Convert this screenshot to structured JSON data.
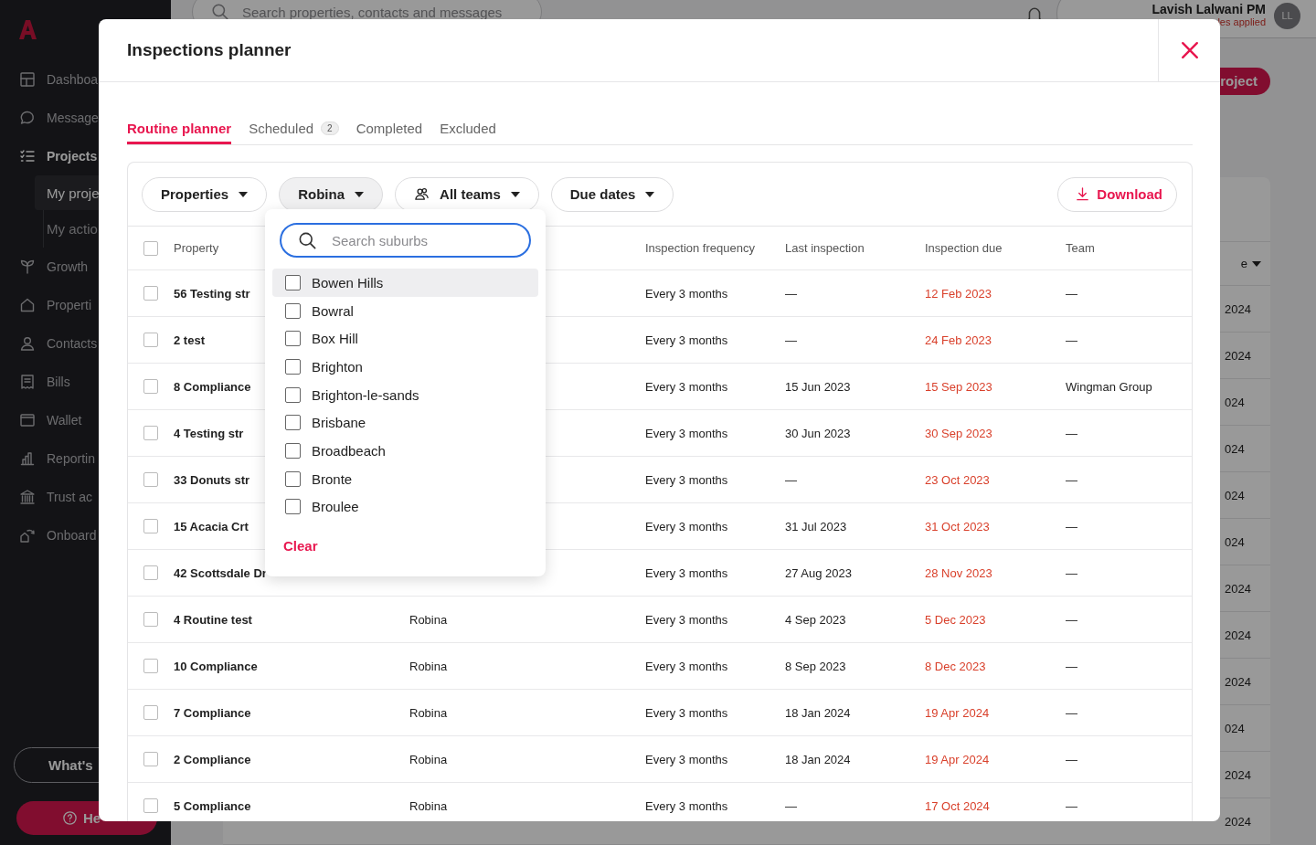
{
  "sidebar": {
    "items": [
      {
        "label": "Dashboa",
        "selected": false
      },
      {
        "label": "Message",
        "selected": false
      },
      {
        "label": "Projects",
        "selected": true,
        "children": [
          {
            "label": "My proje",
            "selected": true
          },
          {
            "label": "My actio",
            "selected": false
          }
        ]
      },
      {
        "label": "Growth",
        "selected": false
      },
      {
        "label": "Properti",
        "selected": false
      },
      {
        "label": "Contacts",
        "selected": false
      },
      {
        "label": "Bills",
        "selected": false
      },
      {
        "label": "Wallet",
        "selected": false
      },
      {
        "label": "Reportin",
        "selected": false
      },
      {
        "label": "Trust ac",
        "selected": false
      },
      {
        "label": "Onboard",
        "selected": false
      }
    ],
    "whats_new_button": "What's",
    "help_button": "He"
  },
  "top_bar": {
    "search": {
      "placeholder": "Search properties, contacts and messages"
    },
    "user": {
      "name": "Lavish Lalwani PM",
      "subtitle": "les applied",
      "avatar": "LL"
    }
  },
  "background": {
    "new_button": "roject",
    "sort_header": "e",
    "column_fragments": [
      "2024",
      "2024",
      "024",
      "024",
      "024",
      "024",
      "2024",
      "2024",
      "2024",
      "024",
      "2024",
      "2024"
    ]
  },
  "modal": {
    "title": "Inspections planner",
    "tabs": [
      {
        "label": "Routine planner",
        "selected": true
      },
      {
        "label": "Scheduled",
        "badge": "2",
        "selected": false
      },
      {
        "label": "Completed",
        "selected": false
      },
      {
        "label": "Excluded",
        "selected": false
      }
    ],
    "filters": [
      {
        "label": "Properties",
        "kind": "plain",
        "open": false
      },
      {
        "label": "Robina",
        "kind": "plain",
        "open": true
      },
      {
        "label": "All teams",
        "kind": "team",
        "open": false
      },
      {
        "label": "Due dates",
        "kind": "plain",
        "open": false
      }
    ],
    "download_button": "Download",
    "table": {
      "columns": [
        "Property",
        null,
        "Inspection frequency",
        "Last inspection",
        "Inspection due",
        "Team"
      ],
      "all_checked": false,
      "rows": [
        {
          "checked": false,
          "property": "56 Testing str",
          "frequency": "Every 3 months",
          "last": "—",
          "due": "12 Feb 2023",
          "team": "—"
        },
        {
          "checked": false,
          "property": "2 test",
          "frequency": "Every 3 months",
          "last": "—",
          "due": "24 Feb 2023",
          "team": "—"
        },
        {
          "checked": false,
          "property": "8 Compliance",
          "frequency": "Every 3 months",
          "last": "15 Jun 2023",
          "due": "15 Sep 2023",
          "team": "Wingman Group"
        },
        {
          "checked": false,
          "property": "4 Testing str",
          "frequency": "Every 3 months",
          "last": "30 Jun 2023",
          "due": "30 Sep 2023",
          "team": "—"
        },
        {
          "checked": false,
          "property": "33 Donuts str",
          "frequency": "Every 3 months",
          "last": "—",
          "due": "23 Oct 2023",
          "team": "—"
        },
        {
          "checked": false,
          "property": "15 Acacia Crt",
          "frequency": "Every 3 months",
          "last": "31 Jul 2023",
          "due": "31 Oct 2023",
          "team": "—"
        },
        {
          "checked": false,
          "property": "42 Scottsdale Dr",
          "frequency": "Every 3 months",
          "last": "27 Aug 2023",
          "due": "28 Nov 2023",
          "team": "—"
        },
        {
          "checked": false,
          "property": "4 Routine test",
          "suburb": "Robina",
          "frequency": "Every 3 months",
          "last": "4 Sep 2023",
          "due": "5 Dec 2023",
          "team": "—"
        },
        {
          "checked": false,
          "property": "10 Compliance",
          "suburb": "Robina",
          "frequency": "Every 3 months",
          "last": "8 Sep 2023",
          "due": "8 Dec 2023",
          "team": "—"
        },
        {
          "checked": false,
          "property": "7 Compliance",
          "suburb": "Robina",
          "frequency": "Every 3 months",
          "last": "18 Jan 2024",
          "due": "19 Apr 2024",
          "team": "—"
        },
        {
          "checked": false,
          "property": "2 Compliance",
          "suburb": "Robina",
          "frequency": "Every 3 months",
          "last": "18 Jan 2024",
          "due": "19 Apr 2024",
          "team": "—"
        },
        {
          "checked": false,
          "property": "5 Compliance",
          "suburb": "Robina",
          "frequency": "Every 3 months",
          "last": "—",
          "due": "17 Oct 2024",
          "team": "—"
        }
      ]
    },
    "suburb_dropdown": {
      "search": {
        "placeholder": "Search suburbs"
      },
      "options": [
        {
          "label": "Bowen Hills",
          "checked": false,
          "highlighted": true
        },
        {
          "label": "Bowral",
          "checked": false,
          "highlighted": false
        },
        {
          "label": "Box Hill",
          "checked": false,
          "highlighted": false
        },
        {
          "label": "Brighton",
          "checked": false,
          "highlighted": false
        },
        {
          "label": "Brighton-le-sands",
          "checked": false,
          "highlighted": false
        },
        {
          "label": "Brisbane",
          "checked": false,
          "highlighted": false
        },
        {
          "label": "Broadbeach",
          "checked": false,
          "highlighted": false
        },
        {
          "label": "Bronte",
          "checked": false,
          "highlighted": false
        },
        {
          "label": "Broulee",
          "checked": false,
          "highlighted": false
        }
      ],
      "clear_button": "Clear"
    }
  }
}
